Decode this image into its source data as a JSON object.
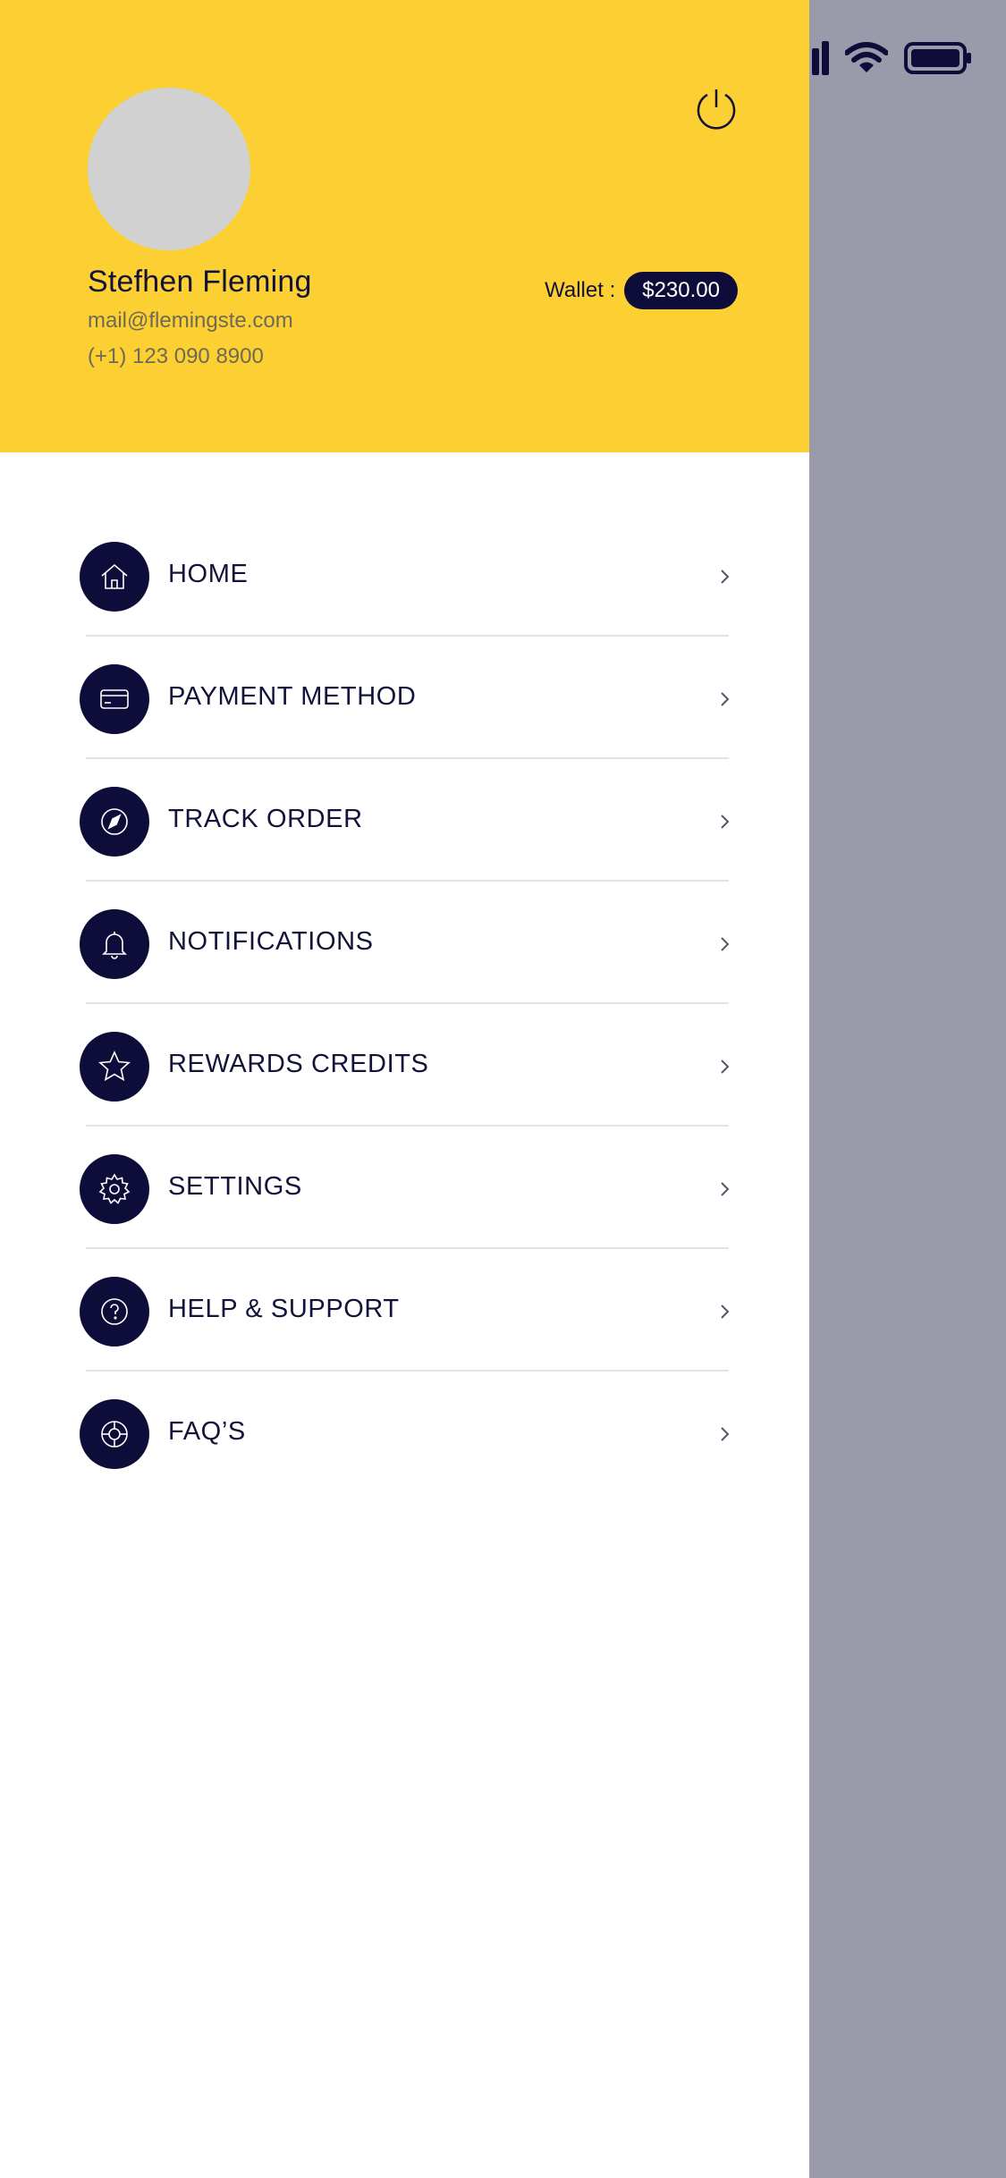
{
  "profile": {
    "name": "Stefhen Fleming",
    "email": "mail@flemingste.com",
    "phone": "(+1) 123 090 8900",
    "avatar_color": "#d1d1d1"
  },
  "wallet": {
    "label": "Wallet :",
    "amount": "$230.00"
  },
  "colors": {
    "header_bg": "#fccf33",
    "accent_dark": "#0e0d3a",
    "overlay": "#9a9aaa"
  },
  "menu": {
    "items": [
      {
        "label": "HOME",
        "icon": "home-icon"
      },
      {
        "label": "PAYMENT METHOD",
        "icon": "credit-card-icon"
      },
      {
        "label": "TRACK ORDER",
        "icon": "navigation-icon"
      },
      {
        "label": "NOTIFICATIONS",
        "icon": "bell-icon"
      },
      {
        "label": "REWARDS CREDITS",
        "icon": "star-icon"
      },
      {
        "label": "SETTINGS",
        "icon": "gear-icon"
      },
      {
        "label": "HELP & SUPPORT",
        "icon": "help-circle-icon"
      },
      {
        "label": "FAQ’S",
        "icon": "lifebuoy-icon"
      }
    ]
  }
}
